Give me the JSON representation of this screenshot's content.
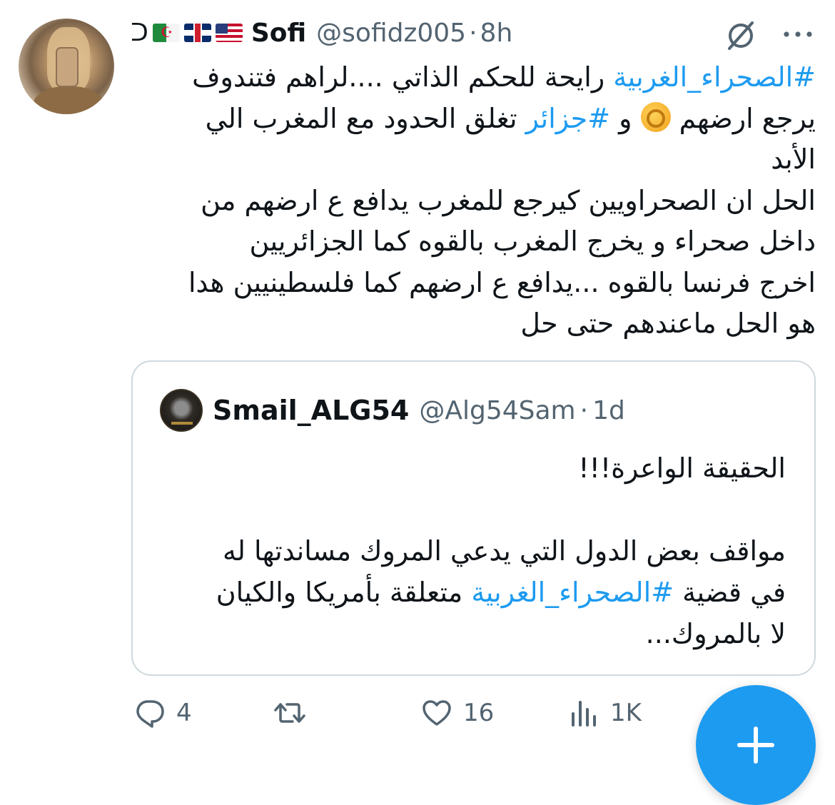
{
  "author": {
    "wave": "ᑐ",
    "flags": [
      "algeria-flag",
      "uk-flag",
      "us-flag"
    ],
    "name": "Sofi",
    "handle": "@sofidz005",
    "dot": "·",
    "time": "8h"
  },
  "tweet": {
    "lines": [
      {
        "before": "",
        "hashtag": "#الصحراء_الغربية",
        "after": " رايحة للحكم الذاتي ....لراهم فتندوف"
      },
      {
        "before": "يرجع ارضهم ",
        "emoji": "ok-hand-emoji",
        "mid": " و ",
        "hashtag": "#جزائر",
        "after": " تغلق الحدود مع المغرب الي"
      },
      {
        "text": "الأبد"
      },
      {
        "text": "الحل ان الصحراويين كيرجع للمغرب يدافع ع ارضهم من"
      },
      {
        "text": "داخل صحراء و يخرج المغرب بالقوه  كما الجزائريين"
      },
      {
        "text": "اخرج فرنسا بالقوه ...يدافع ع ارضهم كما فلسطينيين هدا"
      },
      {
        "text": "هو الحل ماعندهم حتى حل"
      }
    ]
  },
  "quote": {
    "name": "Smail_ALG54",
    "handle": "@Alg54Sam",
    "dot": "·",
    "time": "1d",
    "line1": "الحقيقة الواعرة!!!",
    "line2": "مواقف بعض الدول التي يدعي المروك مساندتها له",
    "line3_before": "في قضية ",
    "line3_hashtag": "#الصحراء_الغربية",
    "line3_after": " متعلقة بأمريكا والكيان",
    "line4": "لا بالمروك..."
  },
  "actions": {
    "replies": "4",
    "retweets": "",
    "likes": "16",
    "views": "1K"
  },
  "colors": {
    "accent": "#1d9bf0",
    "muted": "#536471",
    "text": "#0f1419",
    "border": "#cfd9de"
  }
}
